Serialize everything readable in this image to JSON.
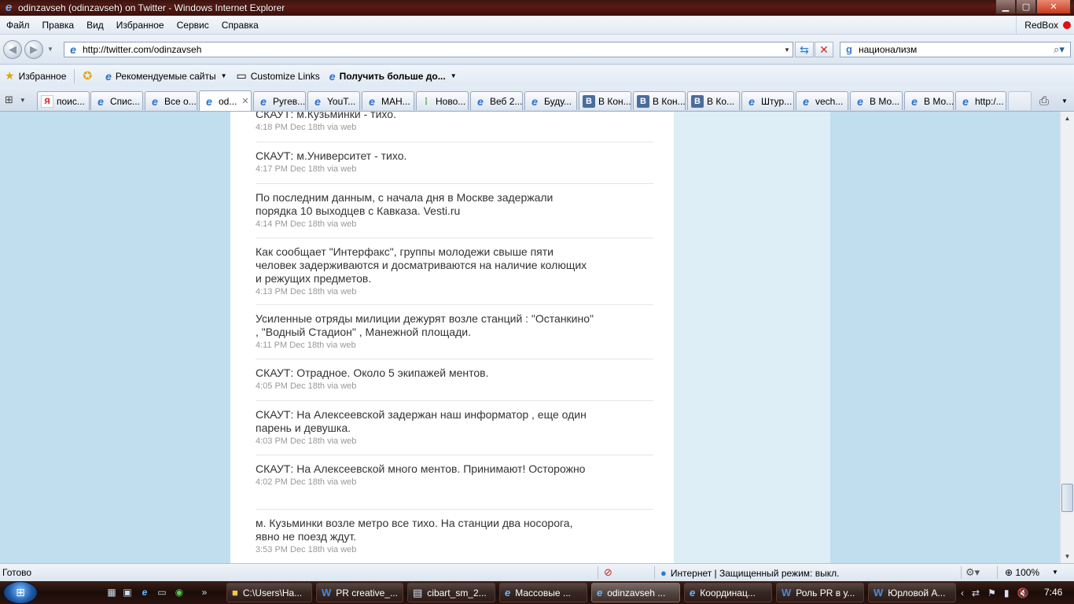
{
  "window": {
    "title": "odinzavseh (odinzavseh) on Twitter - Windows Internet Explorer"
  },
  "menu": {
    "items": [
      "Файл",
      "Правка",
      "Вид",
      "Избранное",
      "Сервис",
      "Справка"
    ],
    "redbox": "RedBox"
  },
  "address_bar": {
    "url": "http://twitter.com/odinzavseh"
  },
  "search": {
    "query": "национализм"
  },
  "favorites_bar": {
    "favorites_label": "Избранное",
    "recommended_label": "Рекомендуемые сайты",
    "customize_label": "Customize Links",
    "more_label": "Получить больше до..."
  },
  "tabs": [
    {
      "label": "поис...",
      "icon": "yandex-icon"
    },
    {
      "label": "Спис...",
      "icon": "ie-icon"
    },
    {
      "label": "Все о...",
      "icon": "ie-icon"
    },
    {
      "label": "od...",
      "icon": "ie-icon",
      "active": true
    },
    {
      "label": "Ругев...",
      "icon": "ie-icon"
    },
    {
      "label": "YouT...",
      "icon": "ie-icon"
    },
    {
      "label": "МАН...",
      "icon": "ie-icon"
    },
    {
      "label": "Ново...",
      "icon": "green-dots-icon"
    },
    {
      "label": "Веб 2...",
      "icon": "ie-icon"
    },
    {
      "label": "Буду...",
      "icon": "ie-icon"
    },
    {
      "label": "В Кон...",
      "icon": "vk-icon"
    },
    {
      "label": "В Кон...",
      "icon": "vk-icon"
    },
    {
      "label": "В Ко...",
      "icon": "vk-icon"
    },
    {
      "label": "Штур...",
      "icon": "ie-icon"
    },
    {
      "label": "vech...",
      "icon": "ie-icon"
    },
    {
      "label": "В Мо...",
      "icon": "ie-icon"
    },
    {
      "label": "В Мо...",
      "icon": "ie-icon"
    },
    {
      "label": "http:/...",
      "icon": "ie-icon"
    }
  ],
  "tweets": [
    {
      "text": "СКАУТ: м.Кузьминки - тихо.",
      "meta": "4:18 PM Dec 18th via web"
    },
    {
      "text": "СКАУТ: м.Университет - тихо.",
      "meta": "4:17 PM Dec 18th via web"
    },
    {
      "text": "По последним данным, с начала дня в Москве задержали порядка 10 выходцев с Кавказа. Vesti.ru",
      "meta": "4:14 PM Dec 18th via web"
    },
    {
      "text": "Как сообщает \"Интерфакс\", группы молодежи свыше пяти человек задерживаются и досматриваются на наличие колющих и режущих предметов.",
      "meta": "4:13 PM Dec 18th via web"
    },
    {
      "text": "Усиленные отряды милиции дежурят возле станций : \"Останкино\" , \"Водный Стадион\" , Манежной площади.",
      "meta": "4:11 PM Dec 18th via web"
    },
    {
      "text": "СКАУТ: Отрадное. Около 5 экипажей ментов.",
      "meta": "4:05 PM Dec 18th via web"
    },
    {
      "text": "СКАУТ: На Алексеевской задержан наш информатор , еще один парень и девушка.",
      "meta": "4:03 PM Dec 18th via web"
    },
    {
      "text": "СКАУТ: На Алексеевской много ментов. Принимают! Осторожно",
      "meta": "4:02 PM Dec 18th via web"
    },
    {
      "text": "м. Кузьминки возле метро все тихо. На станции два носорога, явно не поезд ждут.",
      "meta": "3:53 PM Dec 18th via web"
    }
  ],
  "status_bar": {
    "status": "Готово",
    "zone": "Интернет | Защищенный режим: выкл.",
    "zoom": "100%"
  },
  "taskbar": {
    "tasks": [
      {
        "label": "C:\\Users\\На...",
        "icon": "folder-icon"
      },
      {
        "label": "PR creative_...",
        "icon": "word-icon"
      },
      {
        "label": "cibart_sm_2...",
        "icon": "document-icon"
      },
      {
        "label": "Массовые ...",
        "icon": "ie-icon"
      },
      {
        "label": "odinzavseh ...",
        "icon": "ie-icon",
        "active": true
      },
      {
        "label": "Координац...",
        "icon": "ie-icon"
      },
      {
        "label": "Роль PR в у...",
        "icon": "word-icon"
      },
      {
        "label": "Юрловой А...",
        "icon": "word-icon"
      }
    ],
    "clock": "7:46"
  },
  "colors": {
    "twitter_background": "#c0deed",
    "sidebar_background": "#ddeef6",
    "timestamp_gray": "#999999"
  }
}
